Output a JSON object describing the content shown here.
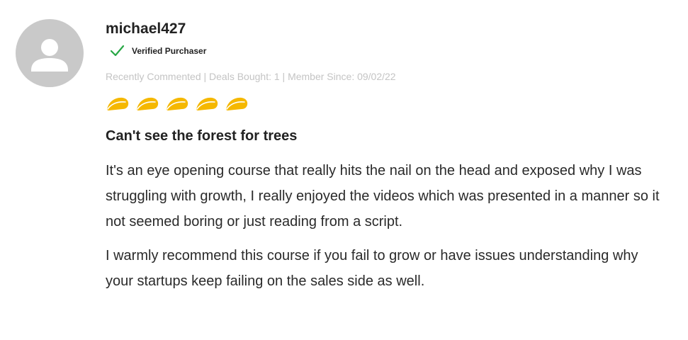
{
  "reviewer": {
    "username": "michael427",
    "verified_label": "Verified Purchaser",
    "meta": "Recently Commented | Deals Bought: 1 | Member Since: 09/02/22",
    "avatar_icon": "user-silhouette-icon"
  },
  "rating": {
    "value": 5,
    "max": 5,
    "icon": "taco-icon",
    "color": "#f5b800"
  },
  "review": {
    "title": "Can't see the forest for trees",
    "paragraphs": [
      "It's an eye opening course that really hits the nail on the head and exposed why I was struggling with growth, I really enjoyed the videos which was presented in a manner so it not seemed boring or just reading from a script.",
      "I warmly recommend this course if you fail to grow or have issues understanding why your startups keep failing on the sales side as well."
    ]
  },
  "colors": {
    "check": "#27a745",
    "avatar_bg": "#c9c9c9",
    "meta_text": "#c4c4c4"
  }
}
